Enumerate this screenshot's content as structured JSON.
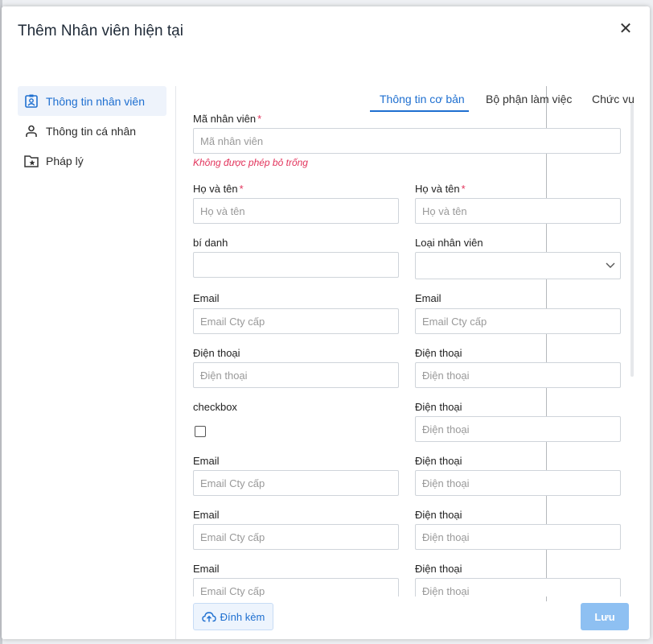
{
  "dialog": {
    "title": "Thêm Nhân viên hiện tại",
    "close_icon": "close-icon"
  },
  "sidebar": {
    "items": [
      {
        "label": "Thông tin nhân viên",
        "icon": "id-badge-icon",
        "active": true
      },
      {
        "label": "Thông tin cá nhân",
        "icon": "user-icon",
        "active": false
      },
      {
        "label": "Pháp lý",
        "icon": "folder-star-icon",
        "active": false
      }
    ]
  },
  "tabs": [
    {
      "label": "Thông tin cơ bản",
      "active": true
    },
    {
      "label": "Bộ phận làm việc",
      "active": false
    },
    {
      "label": "Chức vụ",
      "active": false
    }
  ],
  "form": {
    "employee_code": {
      "label": "Mã nhân viên",
      "required": "*",
      "placeholder": "Mã nhân viên",
      "error": "Không được phép bỏ trống"
    },
    "full_name_1": {
      "label": "Họ và tên",
      "required": "*",
      "placeholder": "Họ và tên"
    },
    "full_name_2": {
      "label": "Họ và tên",
      "required": "*",
      "placeholder": "Họ và tên"
    },
    "alias": {
      "label": "bí danh",
      "value": ""
    },
    "employee_type": {
      "label": "Loại nhân viên",
      "value": ""
    },
    "email_1": {
      "label": "Email",
      "placeholder": "Email Cty cấp"
    },
    "email_2": {
      "label": "Email",
      "placeholder": "Email Cty cấp"
    },
    "phone_1": {
      "label": "Điện thoại",
      "placeholder": "Điện thoại"
    },
    "phone_2": {
      "label": "Điện thoại",
      "placeholder": "Điện thoại"
    },
    "checkbox": {
      "label": "checkbox",
      "checked": false
    },
    "phone_3": {
      "label": "Điện thoại",
      "placeholder": "Điện thoại"
    },
    "email_3": {
      "label": "Email",
      "placeholder": "Email Cty cấp"
    },
    "phone_4": {
      "label": "Điện thoại",
      "placeholder": "Điện thoại"
    },
    "email_4": {
      "label": "Email",
      "placeholder": "Email Cty cấp"
    },
    "phone_5": {
      "label": "Điện thoại",
      "placeholder": "Điện thoại"
    },
    "email_5": {
      "label": "Email",
      "placeholder": "Email Cty cấp"
    },
    "phone_6": {
      "label": "Điện thoại",
      "placeholder": "Điện thoại"
    }
  },
  "footer": {
    "attach_label": "Đính kèm",
    "attach_icon": "cloud-upload-icon",
    "save_label": "Lưu"
  },
  "colors": {
    "accent": "#1e6fd0",
    "error": "#e2335b",
    "save_disabled": "#8ec0f2"
  }
}
